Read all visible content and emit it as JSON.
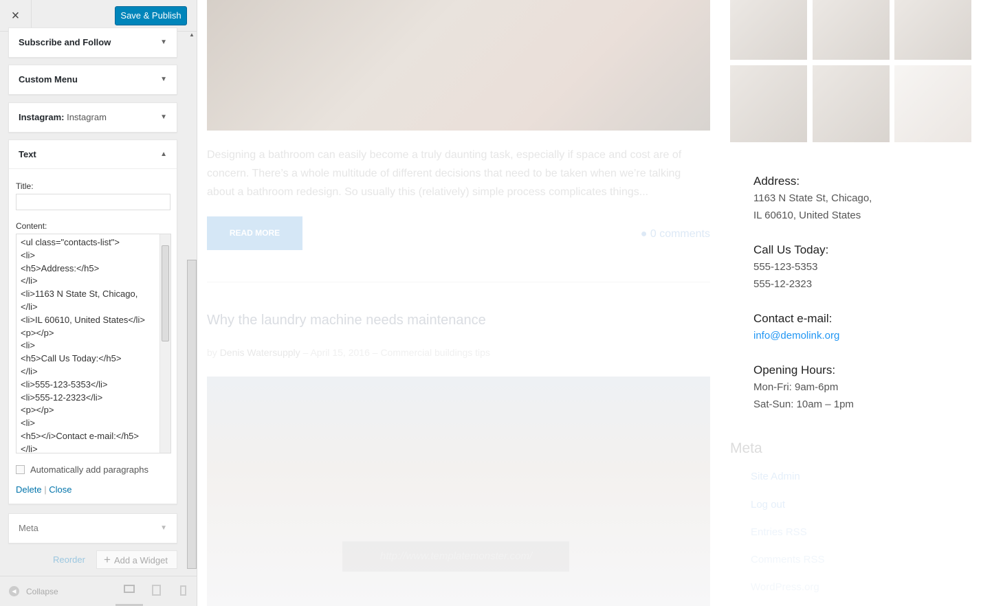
{
  "panel": {
    "close_label": "×",
    "save_label": "Save & Publish",
    "widgets": [
      {
        "title": "Subscribe and Follow"
      },
      {
        "title": "Custom Menu"
      },
      {
        "title": "Instagram:",
        "subtitle": "Instagram"
      },
      {
        "title": "Text"
      },
      {
        "title": "Meta"
      }
    ],
    "text_widget": {
      "title_label": "Title:",
      "title_value": "",
      "content_label": "Content:",
      "content": "<ul class=\"contacts-list\">\n<li>\n<h5>Address:</h5>\n</li>\n<li>1163 N State St, Chicago,\n</li>\n<li>IL 60610, United States</li>\n<p></p>\n<li>\n<h5>Call Us Today:</h5>\n</li>\n<li>555-123-5353</li>\n<li>555-12-2323</li>\n<p></p>\n<li>\n<h5></i>Contact e-mail:</h5>\n</li>",
      "auto_paragraphs_label": "Automatically add paragraphs",
      "auto_paragraphs_checked": false,
      "delete_label": "Delete",
      "separator": "|",
      "close_label": "Close"
    },
    "reorder_label": "Reorder",
    "add_widget_label": "Add a Widget",
    "collapse_label": "Collapse"
  },
  "main": {
    "excerpt": "Designing a bathroom can easily become a truly daunting task, especially if space and cost are of concern. There’s a whole multitude of different decisions that need to be taken when we’re talking about a bathroom redesign. So usually this (relatively) simple process complicates things...",
    "read_more": "READ MORE",
    "comments": "0 comments",
    "post_title": "Why the laundry machine needs maintenance",
    "by": "by",
    "author": "Denis Watersupply",
    "date": "– April 15, 2016 –",
    "category": "Commercial buildings tips",
    "image_link": "http://www.templatemonster.com/"
  },
  "sidebar": {
    "contacts": [
      {
        "heading": "Address:",
        "lines": [
          "1163 N State St, Chicago,",
          "IL 60610, United States"
        ]
      },
      {
        "heading": "Call Us Today:",
        "lines": [
          "555-123-5353",
          "555-12-2323"
        ]
      },
      {
        "heading": "Contact e-mail:",
        "lines": [
          "info@demolink.org"
        ]
      },
      {
        "heading": "Opening Hours:",
        "lines": [
          "Mon-Fri: 9am-6pm",
          "Sat-Sun: 10am – 1pm"
        ]
      }
    ],
    "meta_title": "Meta",
    "meta_items": [
      "Site Admin",
      "Log out",
      "Entries RSS",
      "Comments RSS",
      "WordPress.org"
    ]
  }
}
